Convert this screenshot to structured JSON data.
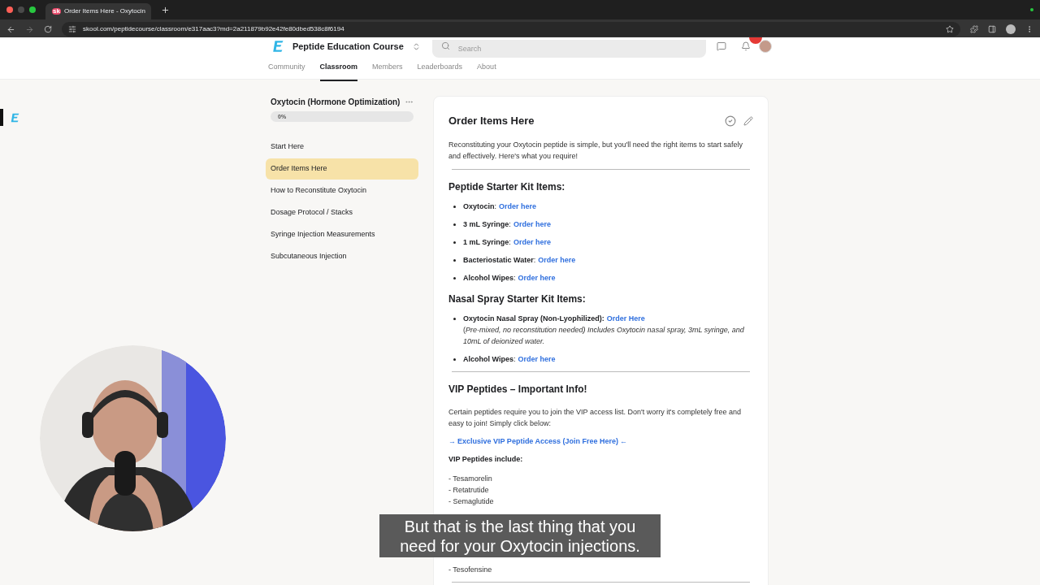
{
  "browser": {
    "tab_title": "Order Items Here - Oxytocin",
    "favicon": "sk",
    "url": "skool.com/peptidecourse/classroom/e317aac3?md=2a211879b92e42fe80dbed538c8f6194"
  },
  "header": {
    "course_title": "Peptide Education Course",
    "search_placeholder": "Search",
    "nav": [
      {
        "label": "Community",
        "selected": false
      },
      {
        "label": "Classroom",
        "selected": true
      },
      {
        "label": "Members",
        "selected": false
      },
      {
        "label": "Leaderboards",
        "selected": false
      },
      {
        "label": "About",
        "selected": false
      }
    ]
  },
  "sidebar": {
    "course_title": "Oxytocin (Hormone Optimization)",
    "progress": {
      "label": "0%",
      "level": 0
    },
    "lessons": [
      {
        "label": "Start Here",
        "selected": false
      },
      {
        "label": "Order Items Here",
        "selected": true
      },
      {
        "label": "How to Reconstitute Oxytocin",
        "selected": false
      },
      {
        "label": "Dosage Protocol / Stacks",
        "selected": false
      },
      {
        "label": "Syringe Injection Measurements",
        "selected": false
      },
      {
        "label": "Subcutaneous Injection",
        "selected": false
      }
    ]
  },
  "lesson": {
    "title": "Order Items Here",
    "intro": "Reconstituting your Oxytocin peptide is simple, but you'll need the right items to start safely and effectively. Here's what you require!",
    "sections": [
      {
        "heading": "Peptide Starter Kit Items:",
        "items": [
          {
            "name": "**Oxytocin**:",
            "link": "Order here"
          },
          {
            "name": "**3 mL Syringe**:",
            "link": "Order here"
          },
          {
            "name": "**1 mL Syringe**:",
            "link": "Order here"
          },
          {
            "name": "**Bacteriostatic Water**:",
            "link": "Order here"
          },
          {
            "name": "**Alcohol Wipes**:",
            "link": "Order here"
          }
        ]
      },
      {
        "heading": "Nasal Spray Starter Kit Items:",
        "items": [
          {
            "name": "**Oxytocin Nasal Spray (Non-Lyophilized):**",
            "link": "Order Here",
            "note": "(*Pre-mixed, no reconstitution needed) Includes Oxytocin nasal spray, 3mL syringe, and 10mL of deionized water.*"
          },
          {
            "name": "**Alcohol Wipes**:",
            "link": "Order here"
          }
        ]
      }
    ],
    "vip": {
      "heading": "VIP Peptides – Important Info!",
      "text": "Certain peptides require you to join the VIP access list. Don't worry it's completely free and easy to join! Simply click below:",
      "arrow_left": "→",
      "link": "Exclusive VIP Peptide Access (Join Free Here)",
      "arrow_right": "←",
      "include_label": "VIP Peptides include:",
      "peptides": [
        "- Tesamorelin",
        "- Retatrutide",
        "- Semaglutide"
      ],
      "peptides_after_caption": [
        "- Tesofensine"
      ]
    }
  },
  "caption": [
    "But that is the last thing that you",
    "need for your Oxytocin injections."
  ]
}
